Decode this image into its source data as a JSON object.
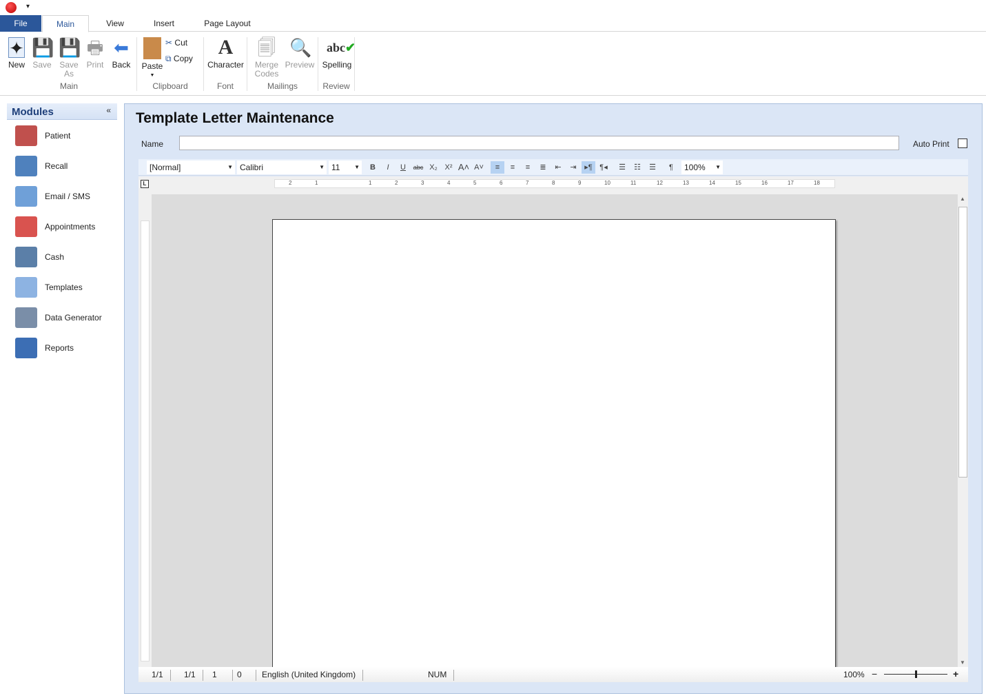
{
  "app": {
    "quick_access": "▾"
  },
  "tabs": [
    "File",
    "Main",
    "View",
    "Insert",
    "Page Layout"
  ],
  "ribbon": {
    "buttons": {
      "new": "New",
      "save": "Save",
      "save_as": "Save As",
      "print": "Print",
      "back": "Back",
      "paste": "Paste",
      "cut": "Cut",
      "copy": "Copy",
      "character": "Character",
      "merge_codes": "Merge Codes",
      "preview": "Preview",
      "spelling": "Spelling"
    },
    "groups": [
      "Main",
      "Clipboard",
      "Font",
      "Mailings",
      "Review"
    ]
  },
  "modules": {
    "title": "Modules",
    "collapse": "«",
    "items": [
      {
        "label": "Patient",
        "color": "#c0504d"
      },
      {
        "label": "Recall",
        "color": "#4f81bd"
      },
      {
        "label": "Email / SMS",
        "color": "#6fa0d8"
      },
      {
        "label": "Appointments",
        "color": "#d9534f"
      },
      {
        "label": "Cash",
        "color": "#5b7fa8"
      },
      {
        "label": "Templates",
        "color": "#8db3e2"
      },
      {
        "label": "Data Generator",
        "color": "#7a8ea8"
      },
      {
        "label": "Reports",
        "color": "#3c6eb4"
      }
    ]
  },
  "form": {
    "title": "Template Letter Maintenance",
    "name_label": "Name",
    "name_value": "",
    "auto_print_label": "Auto Print",
    "auto_print_checked": false
  },
  "editor": {
    "style": "[Normal]",
    "font": "Calibri",
    "size": "11",
    "zoom": "100%",
    "ruler_labels": [
      "2",
      "1",
      "1",
      "2",
      "3",
      "4",
      "5",
      "6",
      "7",
      "8",
      "9",
      "10",
      "11",
      "12",
      "13",
      "14",
      "15",
      "16",
      "17",
      "18"
    ]
  },
  "status": {
    "page": "1/1",
    "section": "1/1",
    "line": "1",
    "col": "0",
    "language": "English (United Kingdom)",
    "num": "NUM",
    "zoom": "100%",
    "zoom_percent": 100
  }
}
